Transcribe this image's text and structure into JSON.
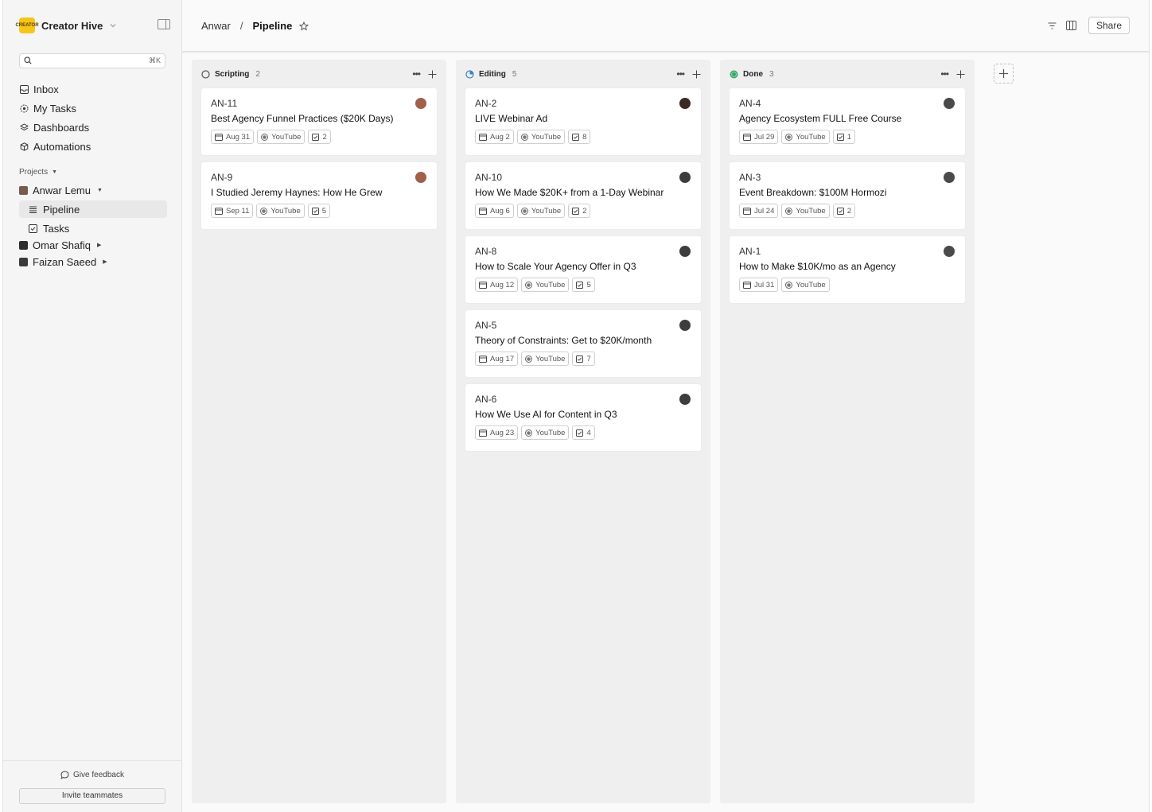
{
  "workspace": {
    "name": "Creator Hive",
    "logo_text": "CREATOR"
  },
  "search": {
    "placeholder": "",
    "shortcut": "⌘K"
  },
  "nav": [
    {
      "label": "Inbox",
      "icon": "inbox-icon"
    },
    {
      "label": "My Tasks",
      "icon": "target-icon"
    },
    {
      "label": "Dashboards",
      "icon": "layers-icon"
    },
    {
      "label": "Automations",
      "icon": "cube-icon"
    }
  ],
  "projects_label": "Projects",
  "projects": {
    "anwar": {
      "label": "Anwar Lemu"
    },
    "sub": [
      {
        "label": "Pipeline",
        "icon": "list-icon"
      },
      {
        "label": "Tasks",
        "icon": "checkbox-icon"
      }
    ],
    "omar": {
      "label": "Omar Shafiq"
    },
    "faizan": {
      "label": "Faizan Saeed"
    }
  },
  "footer": {
    "feedback": "Give feedback",
    "invite": "Invite teammates"
  },
  "breadcrumb": {
    "root": "Anwar",
    "separator": "/",
    "current": "Pipeline"
  },
  "topbar": {
    "share": "Share"
  },
  "columns": [
    {
      "title": "Scripting",
      "count": "2",
      "status_color": "#555555",
      "status": "open-circle",
      "cards": [
        {
          "id": "AN-11",
          "title": "Best Agency Funnel Practices ($20K Days)",
          "date": "Aug 31",
          "channel": "YouTube",
          "checks": "2",
          "avatar_color": "#a0604a"
        },
        {
          "id": "AN-9",
          "title": "I Studied Jeremy Haynes: How He Grew",
          "date": "Sep 11",
          "channel": "YouTube",
          "checks": "5",
          "avatar_color": "#a0604a"
        }
      ]
    },
    {
      "title": "Editing",
      "count": "5",
      "status_color": "#3b82c4",
      "status": "half-circle",
      "cards": [
        {
          "id": "AN-2",
          "title": "LIVE Webinar Ad",
          "date": "Aug 2",
          "channel": "YouTube",
          "checks": "8",
          "avatar_color": "#3a2a24"
        },
        {
          "id": "AN-10",
          "title": "How We Made $20K+ from a 1-Day Webinar",
          "date": "Aug 6",
          "channel": "YouTube",
          "checks": "2",
          "avatar_color": "#3d3d3d"
        },
        {
          "id": "AN-8",
          "title": "How to Scale Your Agency Offer in Q3",
          "date": "Aug 12",
          "channel": "YouTube",
          "checks": "5",
          "avatar_color": "#3d3d3d"
        },
        {
          "id": "AN-5",
          "title": "Theory of Constraints: Get to $20K/month",
          "date": "Aug 17",
          "channel": "YouTube",
          "checks": "7",
          "avatar_color": "#3d3d3d"
        },
        {
          "id": "AN-6",
          "title": "How We Use AI for Content in Q3",
          "date": "Aug 23",
          "channel": "YouTube",
          "checks": "4",
          "avatar_color": "#3d3d3d"
        }
      ]
    },
    {
      "title": "Done",
      "count": "3",
      "status_color": "#3aa76d",
      "status": "filled-circle",
      "cards": [
        {
          "id": "AN-4",
          "title": "Agency Ecosystem FULL Free Course",
          "date": "Jul 29",
          "channel": "YouTube",
          "checks": "1",
          "avatar_color": "#4a4a4a"
        },
        {
          "id": "AN-3",
          "title": "Event Breakdown: $100M Hormozi",
          "date": "Jul 24",
          "channel": "YouTube",
          "checks": "2",
          "avatar_color": "#4a4a4a"
        },
        {
          "id": "AN-1",
          "title": "How to Make $10K/mo as an Agency",
          "date": "Jul 31",
          "channel": "YouTube",
          "checks": "",
          "avatar_color": "#4a4a4a"
        }
      ]
    }
  ]
}
